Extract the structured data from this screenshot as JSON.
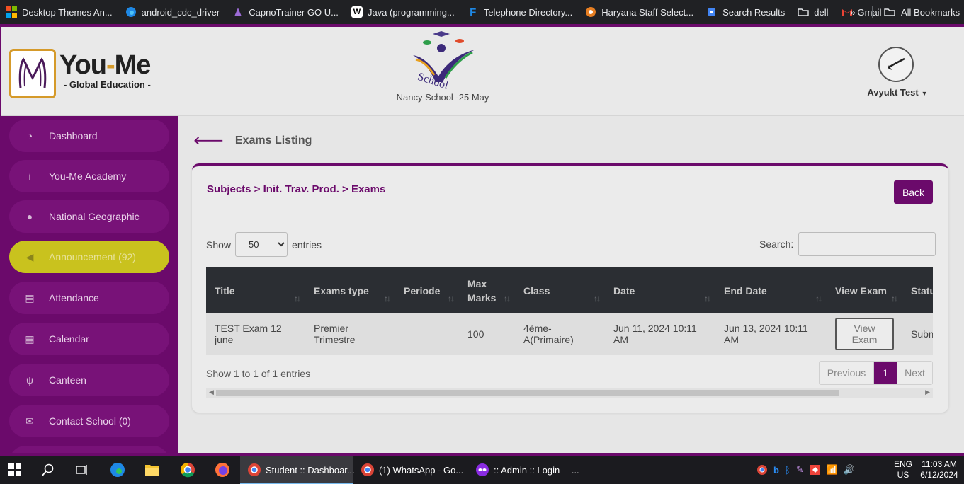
{
  "bookmarks": [
    {
      "label": "Desktop Themes An...",
      "icon": "windows-icon",
      "color": "#f25022"
    },
    {
      "label": "android_cdc_driver",
      "icon": "edge-icon",
      "color": "#1e88e5"
    },
    {
      "label": "CapnoTrainer GO U...",
      "icon": "capno-icon",
      "color": "#9c6bd6"
    },
    {
      "label": "Java (programming...",
      "icon": "wikipedia-icon",
      "color": "#ffffff"
    },
    {
      "label": "Telephone Directory...",
      "icon": "directory-icon",
      "color": "#1e88e5"
    },
    {
      "label": "Haryana Staff Select...",
      "icon": "hssc-icon",
      "color": "#e67e22"
    },
    {
      "label": "Search Results",
      "icon": "search-results-icon",
      "color": "#4285f4"
    },
    {
      "label": "dell",
      "icon": "folder-icon",
      "color": "#e8eaed"
    },
    {
      "label": "Gmail",
      "icon": "gmail-icon",
      "color": "#ea4335"
    }
  ],
  "bookmarks_all": "All Bookmarks",
  "header": {
    "logo_title_a": "You",
    "logo_title_dash": "-",
    "logo_title_b": "Me",
    "logo_sub": "- Global Education -",
    "school_name": "Nancy School -25 May",
    "user": "Avyukt Test"
  },
  "sidebar": [
    {
      "label": "Dashboard",
      "icon": "dashboard-icon",
      "glyph": "◔"
    },
    {
      "label": "You-Me Academy",
      "icon": "info-icon",
      "glyph": "i"
    },
    {
      "label": "National Geographic",
      "icon": "globe-icon",
      "glyph": "●"
    },
    {
      "label": "Announcement (92)",
      "icon": "megaphone-icon",
      "glyph": "◀",
      "active": true
    },
    {
      "label": "Attendance",
      "icon": "id-card-icon",
      "glyph": "▤"
    },
    {
      "label": "Calendar",
      "icon": "calendar-icon",
      "glyph": "▦"
    },
    {
      "label": "Canteen",
      "icon": "utensils-icon",
      "glyph": "ψ"
    },
    {
      "label": "Contact School (0)",
      "icon": "envelope-icon",
      "glyph": "✉"
    }
  ],
  "page": {
    "title": "Exams Listing",
    "breadcrumb": "Subjects > Init. Trav. Prod. > Exams",
    "back_label": "Back",
    "show_label": "Show",
    "entries_label": "entries",
    "length_value": "50",
    "search_label": "Search:",
    "info": "Show 1 to 1 of 1 entries",
    "prev_label": "Previous",
    "page_num": "1",
    "next_label": "Next"
  },
  "table": {
    "columns": [
      "Title",
      "Exams type",
      "Periode",
      "Max Marks",
      "Class",
      "Date",
      "End Date",
      "View Exam",
      "Status"
    ],
    "rows": [
      {
        "title": "TEST Exam 12 june",
        "exams_type": "Premier Trimestre",
        "periode": "",
        "max_marks": "100",
        "class": "4ème-A(Primaire)",
        "date": "Jun 11, 2024 10:11 AM",
        "end_date": "Jun 13, 2024 10:11 AM",
        "view_label": "View Exam",
        "status": "Submitted"
      }
    ]
  },
  "taskbar": {
    "apps": [
      {
        "label": "Student :: Dashboar...",
        "active": true
      },
      {
        "label": "(1) WhatsApp - Go..."
      },
      {
        "label": ":: Admin :: Login —..."
      }
    ],
    "lang_a": "ENG",
    "lang_b": "US",
    "time": "11:03 AM",
    "date": "6/12/2024"
  },
  "colors": {
    "primary": "#6b0a6b",
    "active_nav": "#c9c21e",
    "logo_accent": "#d59a2a"
  }
}
